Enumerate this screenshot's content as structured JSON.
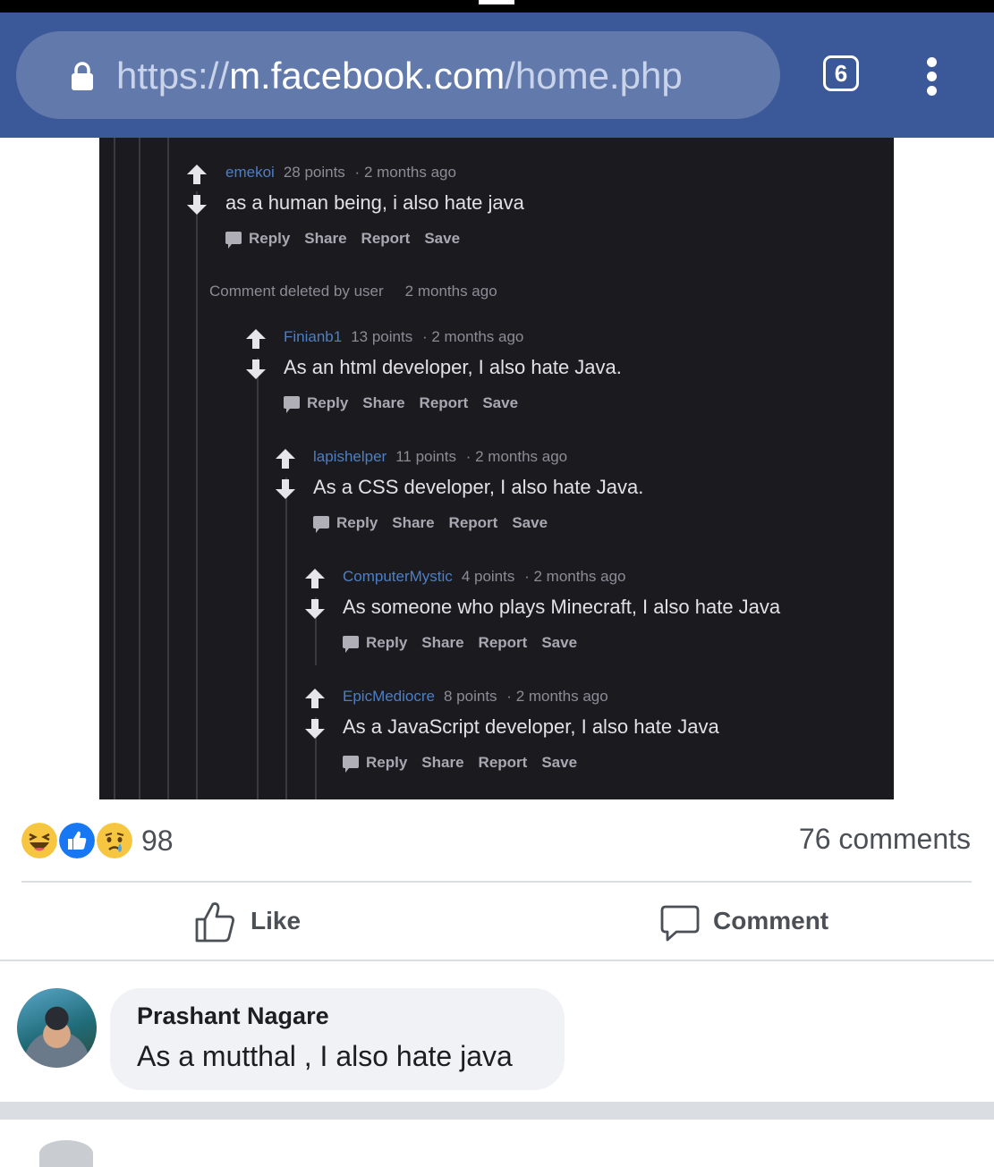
{
  "browser": {
    "url_scheme": "https://",
    "url_host": "m.facebook.com",
    "url_path": "/home.php",
    "tab_count": "6",
    "icons": [
      "lock-icon",
      "tabs-icon",
      "overflow-menu-icon"
    ]
  },
  "thread": {
    "comments": [
      {
        "user": "emekoi",
        "points": "28 points",
        "dot": "·",
        "age": "2 months ago",
        "text": "as a human being, i also hate java"
      },
      {
        "user": "Finianb1",
        "points": "13 points",
        "dot": "·",
        "age": "2 months ago",
        "text": "As an html developer, I also hate Java."
      },
      {
        "user": "lapishelper",
        "points": "11 points",
        "dot": "·",
        "age": "2 months ago",
        "text": "As a CSS developer, I also hate Java."
      },
      {
        "user": "ComputerMystic",
        "points": "4 points",
        "dot": "·",
        "age": "2 months ago",
        "text": "As someone who plays Minecraft, I also hate Java"
      },
      {
        "user": "EpicMediocre",
        "points": "8 points",
        "dot": "·",
        "age": "2 months ago",
        "text": "As a JavaScript developer, I also hate Java"
      }
    ],
    "deleted": {
      "label": "Comment deleted by user",
      "age": "2 months ago"
    },
    "actions": {
      "reply": "Reply",
      "share": "Share",
      "report": "Report",
      "save": "Save"
    }
  },
  "post": {
    "reaction_count": "98",
    "reaction_icons": [
      "haha-reaction-icon",
      "like-reaction-icon",
      "sad-reaction-icon"
    ],
    "comment_count": "76 comments",
    "like_label": "Like",
    "comment_label": "Comment"
  },
  "top_comment": {
    "author": "Prashant Nagare",
    "text": "As a mutthal , I also hate java"
  },
  "colors": {
    "facebook_blue": "#3b5998",
    "url_pill": "#6279ac",
    "reddit_bg": "#1b1a1f",
    "reddit_username": "#4d7fc5",
    "bubble_bg": "#f0f2f5"
  }
}
